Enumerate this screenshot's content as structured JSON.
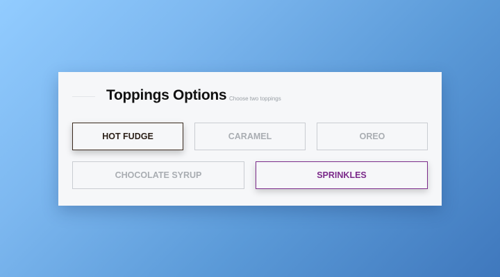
{
  "panel": {
    "title": "Toppings Options",
    "subtitle": "Choose two toppings"
  },
  "options": [
    {
      "label": "HOT FUDGE",
      "selected": true
    },
    {
      "label": "CARAMEL",
      "selected": false
    },
    {
      "label": "OREO",
      "selected": false
    },
    {
      "label": "CHOCOLATE SYRUP",
      "selected": false
    },
    {
      "label": "SPRINKLES",
      "selected": true
    }
  ],
  "colors": {
    "selected_primary": "#2b1f17",
    "selected_accent": "#7b2a8a",
    "unselected_text": "#a9adb2"
  }
}
